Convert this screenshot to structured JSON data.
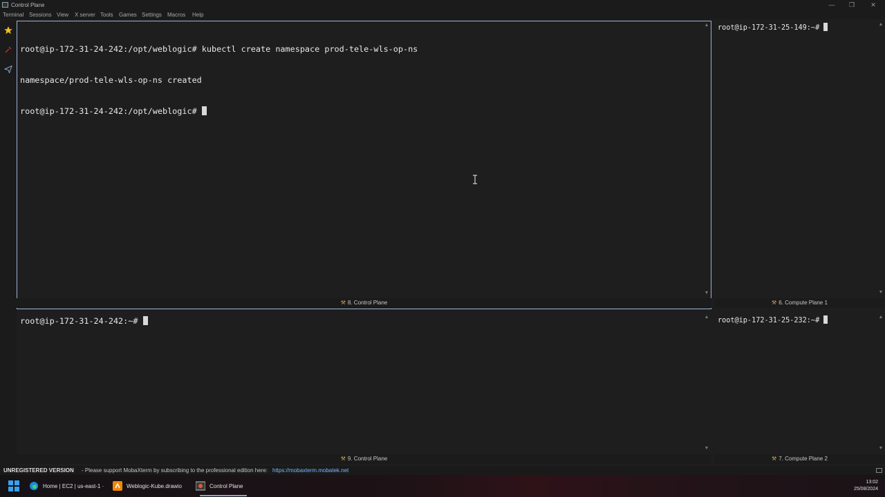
{
  "window": {
    "title": "Control Plane",
    "minimize_glyph": "—",
    "restore_glyph": "❐",
    "close_glyph": "✕"
  },
  "menu": [
    "Terminal",
    "Sessions",
    "View",
    "X server",
    "Tools",
    "Games",
    "Settings",
    "Macros",
    "Help"
  ],
  "sidebar": {
    "icons": [
      "star-icon",
      "tools-icon",
      "send-icon"
    ]
  },
  "panes": {
    "main": {
      "lines": [
        "root@ip-172-31-24-242:/opt/weblogic# kubectl create namespace prod-tele-wls-op-ns",
        "namespace/prod-tele-wls-op-ns created",
        "root@ip-172-31-24-242:/opt/weblogic# "
      ],
      "label": "8. Control Plane"
    },
    "compute1": {
      "prompt": "root@ip-172-31-25-149:~# ",
      "label": "6. Compute Plane 1"
    },
    "bottom": {
      "prompt": "root@ip-172-31-24-242:~# ",
      "label": "9. Control Plane"
    },
    "compute2": {
      "prompt": "root@ip-172-31-25-232:~# ",
      "label": "7. Compute Plane 2"
    }
  },
  "statusbar": {
    "registration": "UNREGISTERED VERSION",
    "message": "-  Please support MobaXterm by subscribing to the professional edition here:",
    "link": "https://mobaxterm.mobatek.net"
  },
  "taskbar": {
    "items": [
      {
        "label": "Home | EC2 | us-east-1 ·",
        "icon": "edge-icon"
      },
      {
        "label": "Weblogic-Kube.drawio",
        "icon": "drawio-icon"
      },
      {
        "label": "Control Plane",
        "icon": "mobaxterm-icon"
      }
    ],
    "time": "13:02",
    "date": "25/08/2024"
  },
  "colors": {
    "background": "#1e1e1e",
    "active_border": "#9ab4d6",
    "link": "#7fb6ff",
    "star": "#f0c020"
  }
}
